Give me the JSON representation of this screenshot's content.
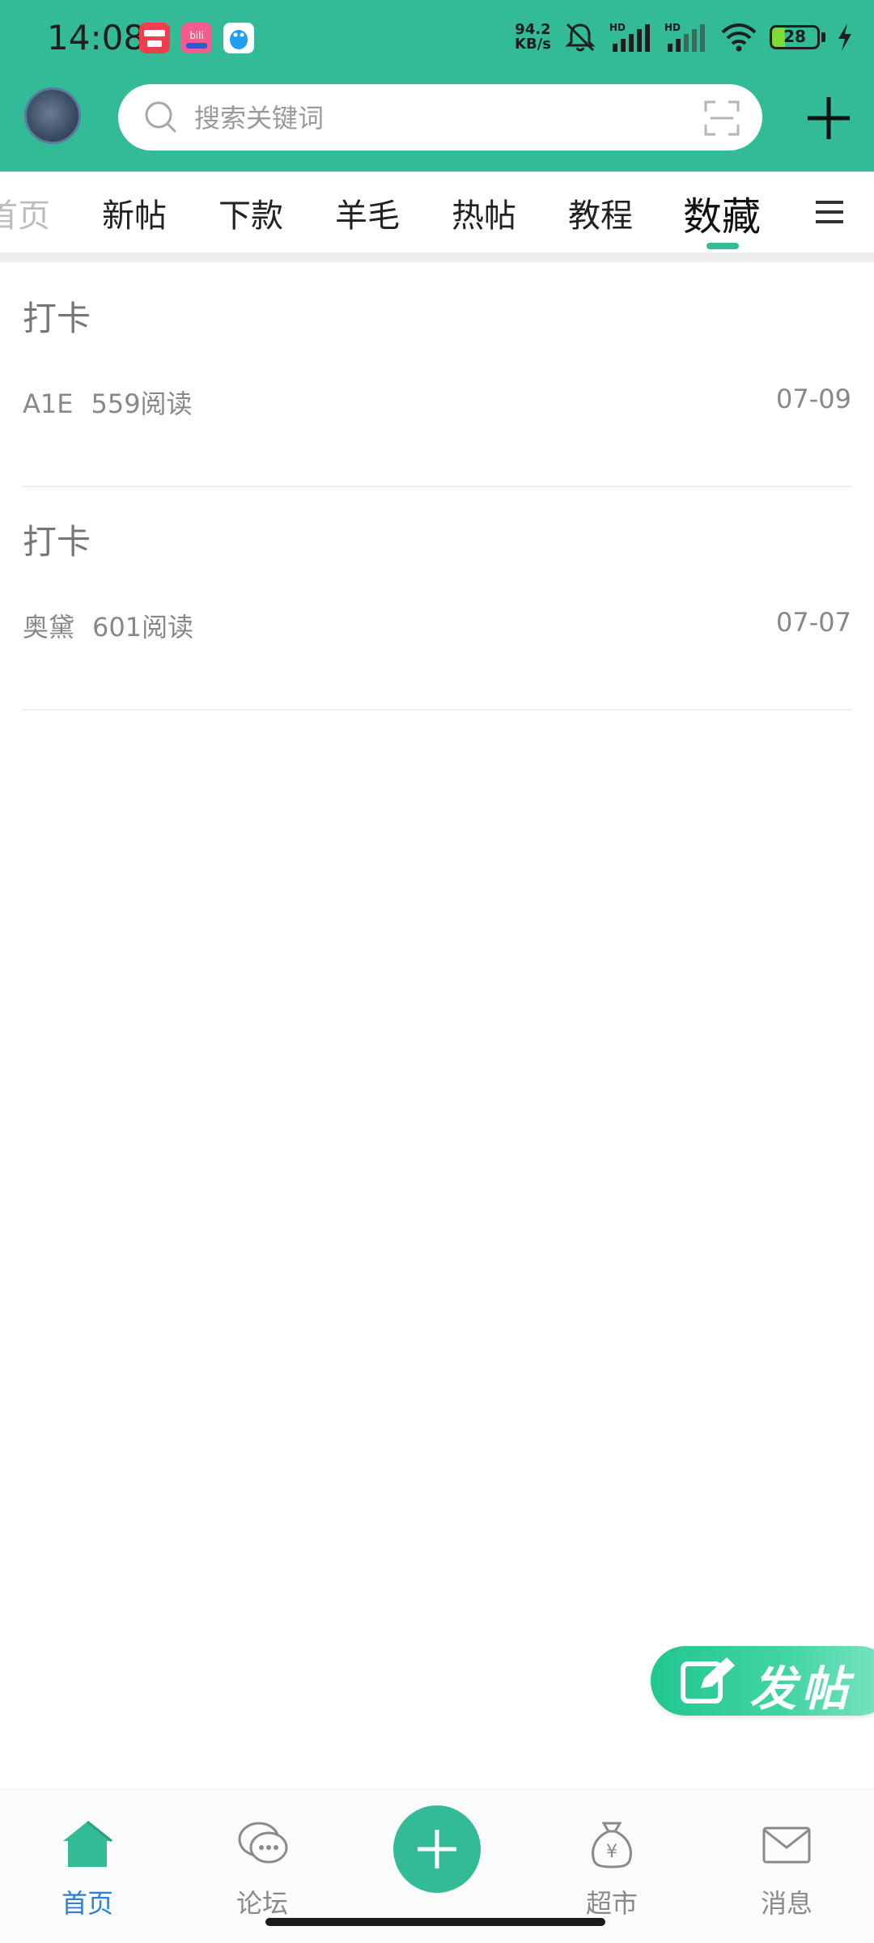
{
  "status_bar": {
    "time": "14:08",
    "net_speed_value": "94.2",
    "net_speed_unit": "KB/s",
    "battery_level": "28",
    "icons": [
      "app-red-icon",
      "app-bilibili-icon",
      "app-qq-icon",
      "mute-bell-icon",
      "signal-hd-icon",
      "signal-hd-icon",
      "wifi-icon",
      "battery-icon",
      "charging-bolt-icon"
    ]
  },
  "header": {
    "search_placeholder": "搜索关键词",
    "icons": [
      "avatar",
      "search-icon",
      "scan-icon",
      "plus-icon"
    ]
  },
  "tabs": [
    {
      "label": "首页"
    },
    {
      "label": "新帖"
    },
    {
      "label": "下款"
    },
    {
      "label": "羊毛"
    },
    {
      "label": "热帖"
    },
    {
      "label": "教程"
    },
    {
      "label": "数藏",
      "active": true
    }
  ],
  "posts": [
    {
      "title": "打卡",
      "author": "A1E",
      "reads": "559阅读",
      "date": "07-09"
    },
    {
      "title": "打卡",
      "author": "奥黛",
      "reads": "601阅读",
      "date": "07-07"
    }
  ],
  "fab": {
    "label": "发帖"
  },
  "bottom_nav": [
    {
      "label": "首页",
      "icon": "home-icon",
      "active": true
    },
    {
      "label": "论坛",
      "icon": "chat-bubbles-icon"
    },
    {
      "label": "",
      "icon": "plus-icon"
    },
    {
      "label": "超市",
      "icon": "money-bag-icon"
    },
    {
      "label": "消息",
      "icon": "mail-icon"
    }
  ],
  "colors": {
    "brand": "#33bb97",
    "active_nav": "#2e7fd6"
  }
}
